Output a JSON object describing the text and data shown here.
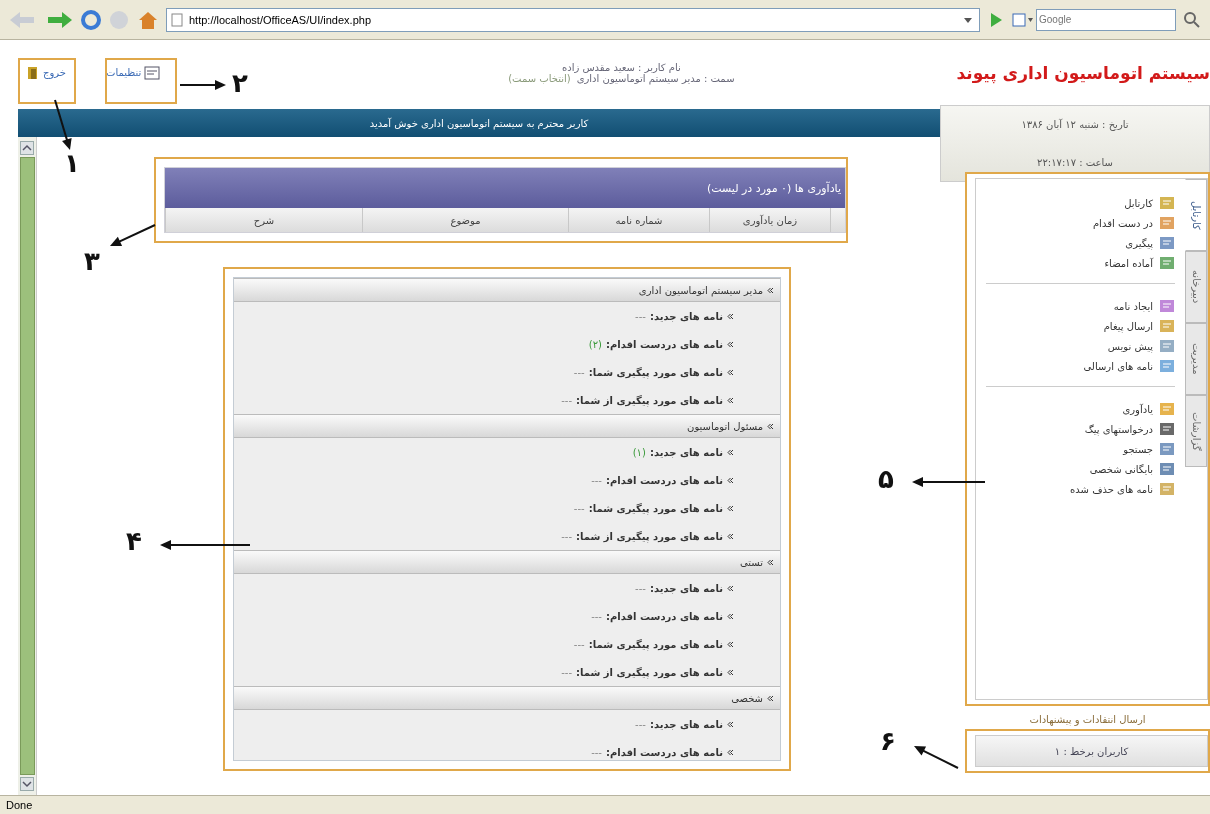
{
  "browser": {
    "url": "http://localhost/OfficeAS/UI/index.php",
    "search_placeholder": "Google",
    "status": "Done"
  },
  "header": {
    "logout": "خروج",
    "settings": "تنظیمات",
    "user_line": "نام کاربر : سعید مقدس زاده",
    "role_line": "سمت : مدیر سیستم اتوماسیون اداری",
    "choose_role": "(انتخاب سمت)",
    "logo": "سیستم اتوماسیون اداری پیوند"
  },
  "welcome": "کاربر محترم به سیستم اتوماسیون اداری خوش آمدید",
  "date": "تاریخ : شنبه ۱۲ آبان ۱۳۸۶",
  "time": "ساعت : ۲۲:۱۷:۱۷",
  "reminders": {
    "title": "یادآوری ها (۰ مورد در لیست)",
    "columns": [
      "زمان یادآوری",
      "شماره نامه",
      "موضوع",
      "شرح"
    ]
  },
  "sections": [
    {
      "title": "مدیر سیستم اتوماسیون اداری",
      "items": [
        {
          "label": "نامه های جدید:",
          "value": "---",
          "has_items": false
        },
        {
          "label": "نامه های دردست اقدام:",
          "value": "(۲)",
          "has_items": true
        },
        {
          "label": "نامه های مورد پیگیری شما:",
          "value": "---",
          "has_items": false
        },
        {
          "label": "نامه های مورد پیگیری از شما:",
          "value": "---",
          "has_items": false
        }
      ]
    },
    {
      "title": "مسئول اتوماسیون",
      "items": [
        {
          "label": "نامه های جدید:",
          "value": "(۱)",
          "has_items": true
        },
        {
          "label": "نامه های دردست اقدام:",
          "value": "---",
          "has_items": false
        },
        {
          "label": "نامه های مورد پیگیری شما:",
          "value": "---",
          "has_items": false
        },
        {
          "label": "نامه های مورد پیگیری از شما:",
          "value": "---",
          "has_items": false
        }
      ]
    },
    {
      "title": "تستی",
      "items": [
        {
          "label": "نامه های جدید:",
          "value": "---",
          "has_items": false
        },
        {
          "label": "نامه های دردست اقدام:",
          "value": "---",
          "has_items": false
        },
        {
          "label": "نامه های مورد پیگیری شما:",
          "value": "---",
          "has_items": false
        },
        {
          "label": "نامه های مورد پیگیری از شما:",
          "value": "---",
          "has_items": false
        }
      ]
    },
    {
      "title": "شخصی",
      "items": [
        {
          "label": "نامه های جدید:",
          "value": "---",
          "has_items": false
        },
        {
          "label": "نامه های دردست اقدام:",
          "value": "---",
          "has_items": false
        }
      ]
    }
  ],
  "side_tabs": [
    {
      "label": "کارتابل",
      "selected": true
    },
    {
      "label": "دبیرخانه",
      "selected": false
    },
    {
      "label": "مدیریت",
      "selected": false
    },
    {
      "label": "گزارشات",
      "selected": false
    }
  ],
  "menu_groups": [
    {
      "items": [
        "کارتابل",
        "در دست اقدام",
        "پیگیری",
        "آماده امضاء"
      ]
    },
    {
      "items": [
        "ایجاد نامه",
        "ارسال پیغام",
        "پیش نویس",
        "نامه های ارسالی"
      ]
    },
    {
      "items": [
        "یادآوری",
        "درخواستهای پیگ",
        "جستجو",
        "بایگانی شخصی",
        "نامه های حذف شده"
      ]
    }
  ],
  "feedback_link": "ارسال انتقادات و پیشنهادات",
  "online_users": "کاربران برخط : ۱",
  "annotations": [
    {
      "label": "۱"
    },
    {
      "label": "۲"
    },
    {
      "label": "۳"
    },
    {
      "label": "۴"
    },
    {
      "label": "۵"
    },
    {
      "label": "۶"
    }
  ]
}
